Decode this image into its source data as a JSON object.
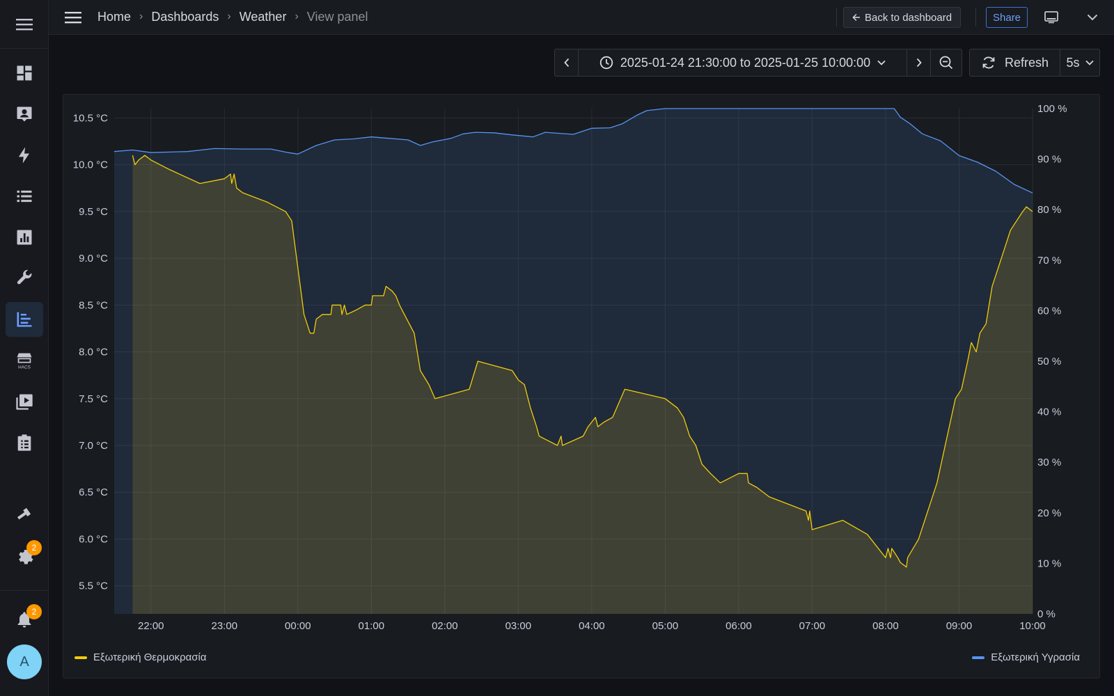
{
  "sidebar": {
    "items": [
      {
        "icon": "dashboard-grid-icon"
      },
      {
        "icon": "person-card-icon"
      },
      {
        "icon": "lightning-icon"
      },
      {
        "icon": "list-icon"
      },
      {
        "icon": "bar-chart-icon"
      },
      {
        "icon": "wrench-icon"
      },
      {
        "icon": "history-chart-icon",
        "active": true
      },
      {
        "icon": "hacs-store-icon"
      },
      {
        "icon": "media-icon"
      },
      {
        "icon": "clipboard-icon"
      },
      {
        "icon": "hammer-icon"
      },
      {
        "icon": "gear-icon",
        "badge": "2"
      }
    ],
    "notifications_badge": "2",
    "avatar_letter": "A"
  },
  "header": {
    "breadcrumb": [
      "Home",
      "Dashboards",
      "Weather",
      "View panel"
    ],
    "back_label": "Back to dashboard",
    "share_label": "Share"
  },
  "time_controls": {
    "range_label": "2025-01-24 21:30:00 to 2025-01-25 10:00:00",
    "refresh_label": "Refresh",
    "refresh_interval": "5s"
  },
  "chart_data": {
    "type": "line",
    "x_ticks": [
      "22:00",
      "23:00",
      "00:00",
      "01:00",
      "02:00",
      "03:00",
      "04:00",
      "05:00",
      "06:00",
      "07:00",
      "08:00",
      "09:00",
      "10:00"
    ],
    "y_left": {
      "unit": "°C",
      "ticks": [
        "10.5 °C",
        "10.0 °C",
        "9.5 °C",
        "9.0 °C",
        "8.5 °C",
        "8.0 °C",
        "7.5 °C",
        "7.0 °C",
        "6.5 °C",
        "6.0 °C",
        "5.5 °C"
      ],
      "range": [
        5.2,
        10.6
      ]
    },
    "y_right": {
      "unit": "%",
      "ticks": [
        "100 %",
        "90 %",
        "80 %",
        "70 %",
        "60 %",
        "50 %",
        "40 %",
        "30 %",
        "20 %",
        "10 %",
        "0 %"
      ],
      "range": [
        0,
        100
      ]
    },
    "legend_placement": "bottom",
    "series": [
      {
        "name": "Εξωτερική Θερμοκρασία",
        "color": "#f2cc0c",
        "axis": "left",
        "points": [
          [
            "21:45",
            10.1
          ],
          [
            "21:47",
            10.0
          ],
          [
            "21:50",
            10.05
          ],
          [
            "21:55",
            10.1
          ],
          [
            "22:00",
            10.05
          ],
          [
            "22:15",
            9.95
          ],
          [
            "22:40",
            9.8
          ],
          [
            "23:00",
            9.85
          ],
          [
            "23:05",
            9.9
          ],
          [
            "23:06",
            9.8
          ],
          [
            "23:08",
            9.9
          ],
          [
            "23:10",
            9.75
          ],
          [
            "23:15",
            9.7
          ],
          [
            "23:35",
            9.6
          ],
          [
            "23:50",
            9.5
          ],
          [
            "23:55",
            9.4
          ],
          [
            "23:57",
            9.2
          ],
          [
            "00:00",
            8.9
          ],
          [
            "00:03",
            8.6
          ],
          [
            "00:05",
            8.4
          ],
          [
            "00:10",
            8.2
          ],
          [
            "00:13",
            8.2
          ],
          [
            "00:15",
            8.35
          ],
          [
            "00:20",
            8.4
          ],
          [
            "00:27",
            8.4
          ],
          [
            "00:28",
            8.5
          ],
          [
            "00:35",
            8.5
          ],
          [
            "00:36",
            8.4
          ],
          [
            "00:38",
            8.5
          ],
          [
            "00:40",
            8.4
          ],
          [
            "00:48",
            8.45
          ],
          [
            "00:55",
            8.5
          ],
          [
            "01:00",
            8.5
          ],
          [
            "01:01",
            8.6
          ],
          [
            "01:10",
            8.6
          ],
          [
            "01:12",
            8.7
          ],
          [
            "01:17",
            8.65
          ],
          [
            "01:20",
            8.6
          ],
          [
            "01:23",
            8.5
          ],
          [
            "01:27",
            8.4
          ],
          [
            "01:35",
            8.2
          ],
          [
            "01:40",
            7.8
          ],
          [
            "01:47",
            7.65
          ],
          [
            "01:52",
            7.5
          ],
          [
            "02:20",
            7.6
          ],
          [
            "02:27",
            7.9
          ],
          [
            "02:55",
            7.8
          ],
          [
            "03:00",
            7.7
          ],
          [
            "03:05",
            7.65
          ],
          [
            "03:10",
            7.4
          ],
          [
            "03:15",
            7.2
          ],
          [
            "03:17",
            7.1
          ],
          [
            "03:32",
            7.0
          ],
          [
            "03:35",
            7.1
          ],
          [
            "03:36",
            7.0
          ],
          [
            "03:53",
            7.1
          ],
          [
            "03:57",
            7.2
          ],
          [
            "04:00",
            7.25
          ],
          [
            "04:03",
            7.3
          ],
          [
            "04:05",
            7.2
          ],
          [
            "04:10",
            7.25
          ],
          [
            "04:17",
            7.3
          ],
          [
            "04:22",
            7.45
          ],
          [
            "04:27",
            7.6
          ],
          [
            "05:00",
            7.5
          ],
          [
            "05:10",
            7.4
          ],
          [
            "05:15",
            7.3
          ],
          [
            "05:20",
            7.1
          ],
          [
            "05:25",
            7.0
          ],
          [
            "05:30",
            6.8
          ],
          [
            "05:37",
            6.7
          ],
          [
            "05:45",
            6.6
          ],
          [
            "06:00",
            6.7
          ],
          [
            "06:07",
            6.7
          ],
          [
            "06:08",
            6.6
          ],
          [
            "06:15",
            6.55
          ],
          [
            "06:25",
            6.45
          ],
          [
            "06:45",
            6.35
          ],
          [
            "06:55",
            6.3
          ],
          [
            "06:57",
            6.2
          ],
          [
            "06:58",
            6.3
          ],
          [
            "07:00",
            6.1
          ],
          [
            "07:25",
            6.2
          ],
          [
            "07:45",
            6.05
          ],
          [
            "08:00",
            5.8
          ],
          [
            "08:02",
            5.9
          ],
          [
            "08:04",
            5.8
          ],
          [
            "08:05",
            5.9
          ],
          [
            "08:10",
            5.8
          ],
          [
            "08:12",
            5.75
          ],
          [
            "08:17",
            5.7
          ],
          [
            "08:18",
            5.8
          ],
          [
            "08:27",
            6.0
          ],
          [
            "08:32",
            6.2
          ],
          [
            "08:37",
            6.4
          ],
          [
            "08:42",
            6.6
          ],
          [
            "08:47",
            6.9
          ],
          [
            "08:52",
            7.2
          ],
          [
            "08:57",
            7.5
          ],
          [
            "09:02",
            7.6
          ],
          [
            "09:07",
            7.9
          ],
          [
            "09:10",
            8.1
          ],
          [
            "09:14",
            8.0
          ],
          [
            "09:17",
            8.2
          ],
          [
            "09:22",
            8.3
          ],
          [
            "09:27",
            8.7
          ],
          [
            "09:32",
            8.9
          ],
          [
            "09:37",
            9.1
          ],
          [
            "09:42",
            9.3
          ],
          [
            "09:47",
            9.4
          ],
          [
            "09:52",
            9.5
          ],
          [
            "09:55",
            9.55
          ],
          [
            "10:00",
            9.5
          ]
        ]
      },
      {
        "name": "Εξωτερική Υγρασία",
        "color": "#5794f2",
        "axis": "right",
        "points": [
          [
            "21:30",
            91.5
          ],
          [
            "21:45",
            91.8
          ],
          [
            "22:00",
            91.3
          ],
          [
            "22:30",
            91.5
          ],
          [
            "22:52",
            92.1
          ],
          [
            "23:15",
            92.0
          ],
          [
            "23:38",
            92.0
          ],
          [
            "23:52",
            91.3
          ],
          [
            "24:00",
            91.0
          ],
          [
            "24:15",
            92.7
          ],
          [
            "24:30",
            93.8
          ],
          [
            "24:45",
            94.0
          ],
          [
            "25:00",
            94.4
          ],
          [
            "25:15",
            94.1
          ],
          [
            "25:30",
            93.8
          ],
          [
            "25:40",
            92.7
          ],
          [
            "25:50",
            93.4
          ],
          [
            "26:05",
            94.1
          ],
          [
            "26:15",
            95.0
          ],
          [
            "26:25",
            95.3
          ],
          [
            "26:40",
            95.2
          ],
          [
            "26:55",
            94.8
          ],
          [
            "27:12",
            94.4
          ],
          [
            "27:22",
            95.3
          ],
          [
            "27:45",
            94.9
          ],
          [
            "28:00",
            96.1
          ],
          [
            "28:15",
            96.2
          ],
          [
            "28:25",
            97.0
          ],
          [
            "28:37",
            98.7
          ],
          [
            "28:45",
            99.6
          ],
          [
            "29:00",
            100.0
          ],
          [
            "29:30",
            100.0
          ],
          [
            "30:00",
            100.0
          ],
          [
            "30:30",
            100.0
          ],
          [
            "31:00",
            100.0
          ],
          [
            "31:30",
            100.0
          ],
          [
            "32:00",
            100.0
          ],
          [
            "32:07",
            100.0
          ],
          [
            "32:12",
            98.3
          ],
          [
            "32:20",
            97.0
          ],
          [
            "32:30",
            95.0
          ],
          [
            "32:45",
            93.6
          ],
          [
            "33:00",
            90.7
          ],
          [
            "33:15",
            89.4
          ],
          [
            "33:30",
            87.6
          ],
          [
            "33:45",
            85.0
          ],
          [
            "34:00",
            83.3
          ]
        ]
      }
    ]
  }
}
